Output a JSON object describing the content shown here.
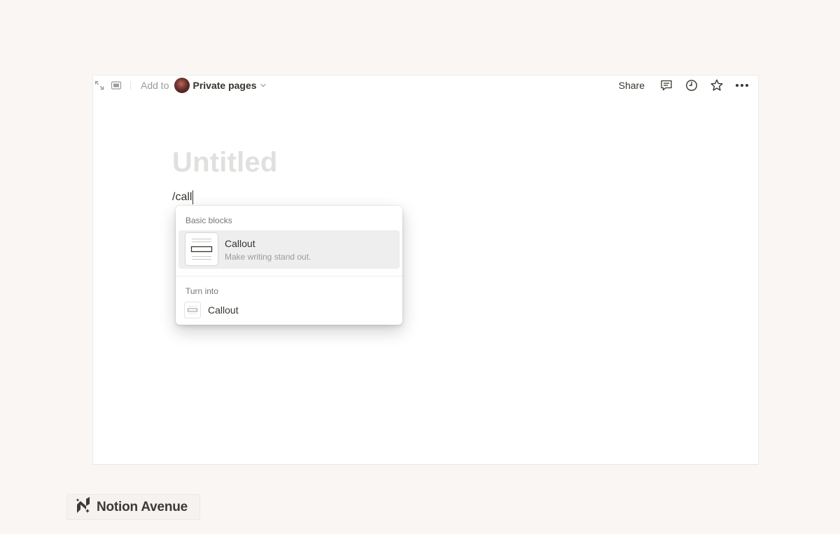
{
  "topbar": {
    "add_to_label": "Add to",
    "location": "Private pages",
    "share_label": "Share",
    "icons": [
      "expand-icon",
      "sidepeek-icon",
      "chevron-down-icon",
      "comment-icon",
      "history-clock-icon",
      "star-icon",
      "more-icon"
    ]
  },
  "page": {
    "title_placeholder": "Untitled",
    "typed_text": "/call"
  },
  "slash_menu": {
    "section_basic": "Basic blocks",
    "callout_title": "Callout",
    "callout_desc": "Make writing stand out.",
    "section_turn_into": "Turn into",
    "turn_into_callout": "Callout"
  },
  "watermark": {
    "brand_name": "Notion Avenue"
  },
  "colors": {
    "background": "#faf6f4",
    "page": "#ffffff",
    "text": "#37352f",
    "placeholder": "#e1e0de",
    "highlight": "#efeeef"
  }
}
